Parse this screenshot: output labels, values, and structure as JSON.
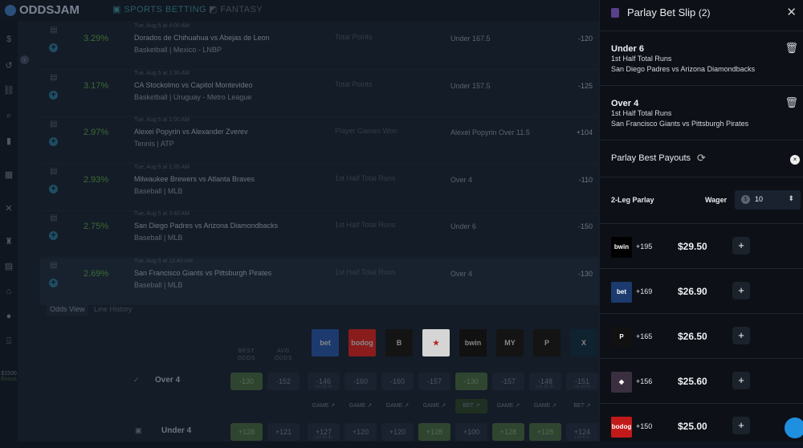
{
  "app": {
    "logo": "ODDSJAM",
    "nav": [
      {
        "label": "SPORTS BETTING",
        "active": true
      },
      {
        "label": "FANTASY",
        "active": false
      }
    ]
  },
  "sidebar": {
    "icons": [
      "dollar-icon",
      "history-icon",
      "parlay-icon",
      "search-icon",
      "chart-icon",
      "grid-icon",
      "tools-icon",
      "trophy-icon",
      "calculator-icon",
      "education-icon",
      "dollar-circle-icon",
      "gift-icon"
    ],
    "promo_amount": "$1500",
    "promo_sub": "Bonus"
  },
  "rows": [
    {
      "pct": "3.29%",
      "date": "Tue, Aug 5 at 4:00 AM",
      "event": "Dorados de Chihuahua vs Abejas de Leon",
      "league": "Basketball | Mexico - LNBP",
      "market": "Total Points",
      "bet": "Under 167.5",
      "odds": "-120"
    },
    {
      "pct": "3.17%",
      "date": "Tue, Aug 5 at 1:35 AM",
      "event": "CA Stockolmo vs Capitol Montevideo",
      "league": "Basketball | Uruguay - Metro League",
      "market": "Total Points",
      "bet": "Under 157.5",
      "odds": "-125"
    },
    {
      "pct": "2.97%",
      "date": "Tue, Aug 5 at 1:00 AM",
      "event": "Alexei Popyrin vs Alexander Zverev",
      "league": "Tennis | ATP",
      "market": "Player Games Won",
      "bet": "Alexei Popyrin Over 11.5",
      "odds": "+104"
    },
    {
      "pct": "2.93%",
      "date": "Tue, Aug 5 at 1:35 AM",
      "event": "Milwaukee Brewers vs Atlanta Braves",
      "league": "Baseball | MLB",
      "market": "1st Half Total Runs",
      "bet": "Over 4",
      "odds": "-110"
    },
    {
      "pct": "2.75%",
      "date": "Tue, Aug 5 at 3:40 AM",
      "event": "San Diego Padres vs Arizona Diamondbacks",
      "league": "Baseball | MLB",
      "market": "1st Half Total Runs",
      "bet": "Under 6",
      "odds": "-150"
    },
    {
      "pct": "2.69%",
      "date": "Tue, Aug 5 at 12:40 AM",
      "event": "San Francisco Giants vs Pittsburgh Pirates",
      "league": "Baseball | MLB",
      "market": "1st Half Total Runs",
      "bet": "Over 4",
      "odds": "-130"
    }
  ],
  "detail": {
    "tabs": [
      "Odds View",
      "Line History"
    ],
    "headers": {
      "best": "BEST ODDS",
      "avg": "AVG ODDS"
    },
    "books": [
      {
        "name": "bet105",
        "label": "bet",
        "bg": "#1c3a6e"
      },
      {
        "name": "bodog",
        "label": "bodog",
        "bg": "#8a1c1c"
      },
      {
        "name": "betonline",
        "label": "B",
        "bg": "#141414"
      },
      {
        "name": "betus",
        "label": "★",
        "bg": "#d5d5d5"
      },
      {
        "name": "bwin",
        "label": "bwin",
        "bg": "#111"
      },
      {
        "name": "mybookie",
        "label": "MY",
        "bg": "#141414"
      },
      {
        "name": "prizepicks",
        "label": "P",
        "bg": "#141414"
      },
      {
        "name": "betanysports",
        "label": "X",
        "bg": "#0f2230"
      }
    ],
    "lines": [
      {
        "name": "Over 4",
        "best": "-130",
        "avg": "-152",
        "odds": [
          {
            "v": "-146",
            "sub": "Lim $1.9k"
          },
          {
            "v": "-160"
          },
          {
            "v": "-160"
          },
          {
            "v": "-157"
          },
          {
            "v": "-130",
            "best": true
          },
          {
            "v": "-157"
          },
          {
            "v": "-148",
            "sub": "Lim $1.9k"
          },
          {
            "v": "-151",
            "sub": "Lim $124"
          }
        ],
        "links": [
          "GAME",
          "GAME",
          "GAME",
          "GAME",
          "BET",
          "GAME",
          "GAME",
          "BET"
        ]
      },
      {
        "name": "Under 4",
        "best": "+128",
        "avg": "+121",
        "odds": [
          {
            "v": "+127",
            "sub": "Lim $1.9k"
          },
          {
            "v": "+120"
          },
          {
            "v": "+120"
          },
          {
            "v": "+128",
            "best": true
          },
          {
            "v": "+100"
          },
          {
            "v": "+128",
            "best": true
          },
          {
            "v": "+128",
            "best": true,
            "sub": "Lim $1.9k"
          },
          {
            "v": "+124",
            "sub": "Lim $70"
          }
        ]
      }
    ]
  },
  "betslip": {
    "title": "Parlay Bet Slip",
    "count": "(2)",
    "legs": [
      {
        "bet": "Under 6",
        "market": "1st Half Total Runs",
        "event": "San Diego Padres vs Arizona Diamondbacks"
      },
      {
        "bet": "Over 4",
        "market": "1st Half Total Runs",
        "event": "San Francisco Giants vs Pittsburgh Pirates"
      }
    ],
    "payouts_title": "Parlay Best Payouts",
    "parlay_label": "2-Leg Parlay",
    "wager_label": "Wager",
    "wager_value": "10",
    "payouts": [
      {
        "book": "bwin",
        "label": "bwin",
        "bg": "#000000",
        "odds": "+195",
        "payout": "$29.50"
      },
      {
        "book": "bet105",
        "label": "bet",
        "bg": "#1c3a6e",
        "odds": "+169",
        "payout": "$26.90"
      },
      {
        "book": "prizepicks",
        "label": "P",
        "bg": "#111111",
        "odds": "+165",
        "payout": "$26.50"
      },
      {
        "book": "fliff",
        "label": "◆",
        "bg": "#3a2f3f",
        "odds": "+156",
        "payout": "$25.60"
      },
      {
        "book": "bodog",
        "label": "bodog",
        "bg": "#c21a1a",
        "odds": "+150",
        "payout": "$25.00"
      }
    ]
  }
}
